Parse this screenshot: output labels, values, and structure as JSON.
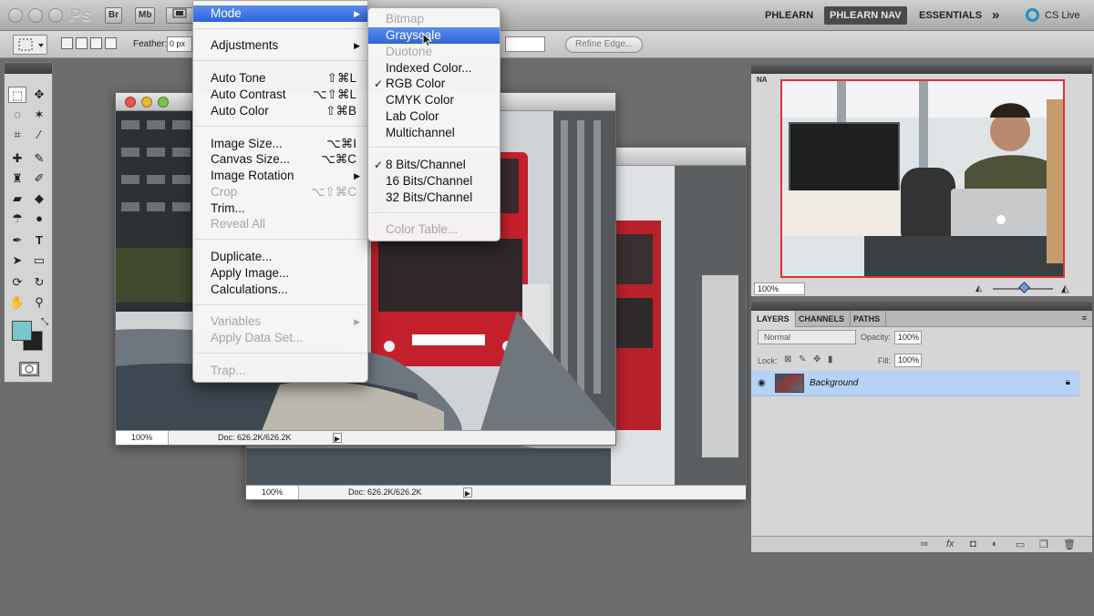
{
  "app_bar": {
    "logo": "Ps",
    "bridge": "Br",
    "mini_bridge": "Mb",
    "workspaces": [
      "PHLEARN",
      "PHLEARN NAV",
      "ESSENTIALS"
    ],
    "more": "»",
    "cs_live": "CS Live"
  },
  "options_bar": {
    "feather_label": "Feather:",
    "feather_value": "0 px",
    "refine_edge": "Refine Edge..."
  },
  "image_menu": {
    "items": [
      {
        "label": "Mode",
        "submenu": true
      },
      {
        "label": "Adjustments",
        "submenu": true
      },
      {
        "label": "Auto Tone",
        "shortcut": "⇧⌘L"
      },
      {
        "label": "Auto Contrast",
        "shortcut": "⌥⇧⌘L"
      },
      {
        "label": "Auto Color",
        "shortcut": "⇧⌘B"
      },
      {
        "label": "Image Size...",
        "shortcut": "⌥⌘I"
      },
      {
        "label": "Canvas Size...",
        "shortcut": "⌥⌘C"
      },
      {
        "label": "Image Rotation",
        "submenu": true
      },
      {
        "label": "Crop",
        "shortcut": "⌥⇧⌘C",
        "disabled": true
      },
      {
        "label": "Trim..."
      },
      {
        "label": "Reveal All",
        "disabled": true
      },
      {
        "label": "Duplicate..."
      },
      {
        "label": "Apply Image..."
      },
      {
        "label": "Calculations..."
      },
      {
        "label": "Variables",
        "submenu": true,
        "disabled": true
      },
      {
        "label": "Apply Data Set...",
        "disabled": true
      },
      {
        "label": "Trap...",
        "disabled": true
      }
    ]
  },
  "mode_menu": {
    "items": [
      {
        "label": "Bitmap",
        "disabled": true
      },
      {
        "label": "Grayscale",
        "highlighted": true
      },
      {
        "label": "Duotone",
        "disabled": true
      },
      {
        "label": "Indexed Color..."
      },
      {
        "label": "RGB Color",
        "checked": true
      },
      {
        "label": "CMYK Color"
      },
      {
        "label": "Lab Color"
      },
      {
        "label": "Multichannel"
      },
      {
        "label": "8 Bits/Channel",
        "checked": true
      },
      {
        "label": "16 Bits/Channel"
      },
      {
        "label": "32 Bits/Channel"
      },
      {
        "label": "Color Table...",
        "disabled": true
      }
    ],
    "check_glyph": "✓"
  },
  "doc_front": {
    "zoom": "100%",
    "doc_info": "Doc: 626.2K/626.2K"
  },
  "doc_back": {
    "zoom": "100%",
    "doc_info": "Doc: 626.2K/626.2K"
  },
  "navigator": {
    "tab": "NA",
    "zoom": "100%"
  },
  "layers_panel": {
    "tabs": [
      "LAYERS",
      "CHANNELS",
      "PATHS"
    ],
    "blend_mode": "Normal",
    "opacity_label": "Opacity:",
    "opacity": "100%",
    "lock_label": "Lock:",
    "fill_label": "Fill:",
    "fill": "100%",
    "layer_name": "Background"
  },
  "colors": {
    "foreground": "#79c7cd",
    "background": "#202020",
    "menu_highlight": "#3a6fe0"
  }
}
